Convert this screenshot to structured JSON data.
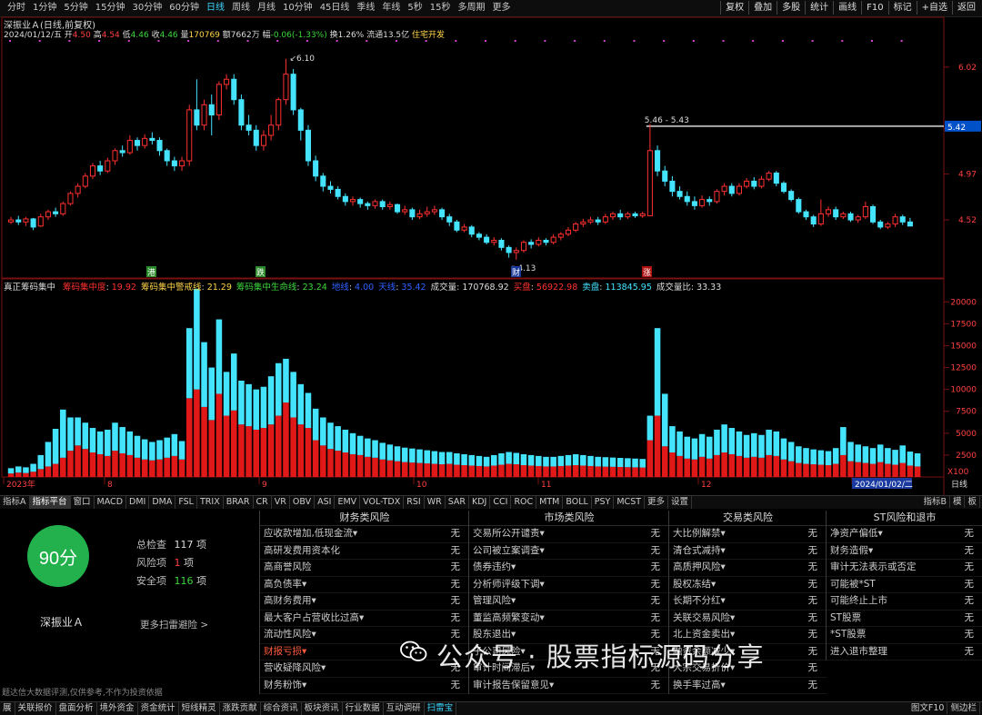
{
  "periods": [
    "分时",
    "1分钟",
    "5分钟",
    "15分钟",
    "30分钟",
    "60分钟",
    "日线",
    "周线",
    "月线",
    "10分钟",
    "45日线",
    "季线",
    "年线",
    "5秒",
    "15秒",
    "多周期",
    "更多"
  ],
  "active_period": "日线",
  "toolbar_right": [
    "复权",
    "叠加",
    "多股",
    "统计",
    "画线",
    "F10",
    "标记",
    "+自选",
    "返回"
  ],
  "stock": {
    "name": "深振业Ａ",
    "mode": "(日线,前复权)"
  },
  "quote": {
    "date": "2024/01/12/五",
    "open_label": "开",
    "open": "4.50",
    "high_label": "高",
    "high": "4.54",
    "low_label": "低",
    "low": "4.46",
    "close_label": "收",
    "close": "4.46",
    "vol_label": "量",
    "vol": "170769",
    "amt_label": "额",
    "amt": "7662万",
    "chg_label": "幅",
    "chg": "-0.06(-1.33%)",
    "turnover": "换1.26%",
    "float": "流通13.5亿",
    "industry": "住宅开发"
  },
  "price_axis": [
    "6.02",
    "5.42",
    "4.97",
    "4.52"
  ],
  "annotations": {
    "high": "6.10",
    "low": "4.13",
    "range": "5.46 - 5.43",
    "current_price": "5.42"
  },
  "markers": {
    "m1": "港",
    "m2": "跌",
    "m3": "财",
    "m4": "涨"
  },
  "vol_axis": [
    "20000",
    "17500",
    "15000",
    "12500",
    "10000",
    "7500",
    "5000",
    "2500",
    "X100"
  ],
  "months": [
    "2023年",
    "8",
    "9",
    "10",
    "11",
    "12",
    "2024/01/02/二"
  ],
  "axis_mode_label": "日线",
  "indicator": {
    "name": "真正筹码集中",
    "items": [
      {
        "label": "筹码集中度",
        "value": "19.92",
        "color": "#ff3030"
      },
      {
        "label": "筹码集中警戒线",
        "value": "21.29",
        "color": "#ffd54a"
      },
      {
        "label": "筹码集中生命线",
        "value": "23.24",
        "color": "#3cd63c"
      },
      {
        "label": "地线",
        "value": "4.00",
        "color": "#3060ff"
      },
      {
        "label": "天线",
        "value": "35.42",
        "color": "#3060ff"
      },
      {
        "label": "成交量",
        "value": "170768.92",
        "color": "#dddddd"
      },
      {
        "label": "买盘",
        "value": "56922.98",
        "color": "#ff3030"
      },
      {
        "label": "卖盘",
        "value": "113845.95",
        "color": "#44e4ff"
      },
      {
        "label": "成交量比",
        "value": "33.33",
        "color": "#dddddd"
      }
    ]
  },
  "indicator_tabs": [
    "指标A",
    "指标平台",
    "窗口",
    "MACD",
    "DMI",
    "DMA",
    "FSL",
    "TRIX",
    "BRAR",
    "CR",
    "VR",
    "OBV",
    "ASI",
    "EMV",
    "VOL-TDX",
    "RSI",
    "WR",
    "SAR",
    "KDJ",
    "CCI",
    "ROC",
    "MTM",
    "BOLL",
    "PSY",
    "MCST",
    "更多",
    "设置"
  ],
  "indicator_tabs_right": [
    "指标B",
    "模",
    "板"
  ],
  "risk": {
    "score": "90分",
    "total_label": "总检查",
    "total": "117",
    "total_unit": "项",
    "risk_label": "风险项",
    "risk_count": "1",
    "risk_unit": "项",
    "safe_label": "安全项",
    "safe": "116",
    "safe_unit": "项",
    "stock_name": "深振业Ａ",
    "more": "更多扫雷避险 >",
    "disclaimer": "题达信大数据评测,仅供参考,不作为投资依据"
  },
  "categories": [
    {
      "title": "财务类风险",
      "items": [
        {
          "label": "应收款增加,低现金流▾",
          "value": "无"
        },
        {
          "label": "高研发费用资本化",
          "value": "无"
        },
        {
          "label": "高商誉风险",
          "value": "无"
        },
        {
          "label": "高负债率▾",
          "value": "无"
        },
        {
          "label": "高财务费用▾",
          "value": "无"
        },
        {
          "label": "最大客户占营收比过高▾",
          "value": "无"
        },
        {
          "label": "流动性风险▾",
          "value": "无"
        },
        {
          "label": "财报亏损▾",
          "value": "",
          "hl": true
        },
        {
          "label": "营收疑降风险▾",
          "value": "无"
        },
        {
          "label": "财务粉饰▾",
          "value": "无"
        }
      ]
    },
    {
      "title": "市场类风险",
      "items": [
        {
          "label": "交易所公开谴责▾",
          "value": "无"
        },
        {
          "label": "公司被立案调查▾",
          "value": "无"
        },
        {
          "label": "债券违约▾",
          "value": "无"
        },
        {
          "label": "分析师评级下调▾",
          "value": "无"
        },
        {
          "label": "管理风险▾",
          "value": "无"
        },
        {
          "label": "董监高频繁变动▾",
          "value": "无"
        },
        {
          "label": "股东退出▾",
          "value": "无"
        },
        {
          "label": "子公司风险▾",
          "value": "无"
        },
        {
          "label": "审计时间滞后▾",
          "value": "无"
        },
        {
          "label": "审计报告保留意见▾",
          "value": "无"
        }
      ]
    },
    {
      "title": "交易类风险",
      "items": [
        {
          "label": "大比例解禁▾",
          "value": "无"
        },
        {
          "label": "清仓式减持▾",
          "value": "无"
        },
        {
          "label": "高质押风险▾",
          "value": "无"
        },
        {
          "label": "股权冻结▾",
          "value": "无"
        },
        {
          "label": "长期不分红▾",
          "value": "无"
        },
        {
          "label": "关联交易风险▾",
          "value": "无"
        },
        {
          "label": "北上资金卖出▾",
          "value": "无"
        },
        {
          "label": "融资余额减少▾",
          "value": "无"
        },
        {
          "label": "大宗交易折价▾",
          "value": "无"
        },
        {
          "label": "换手率过高▾",
          "value": "无"
        }
      ]
    },
    {
      "title": "ST风险和退市",
      "items": [
        {
          "label": "净资产偏低▾",
          "value": "无"
        },
        {
          "label": "财务造假▾",
          "value": "无"
        },
        {
          "label": "审计无法表示或否定",
          "value": "无"
        },
        {
          "label": "可能被*ST",
          "value": "无"
        },
        {
          "label": "可能终止上市",
          "value": "无"
        },
        {
          "label": "ST股票",
          "value": "无"
        },
        {
          "label": "*ST股票",
          "value": "无"
        },
        {
          "label": "进入退市整理",
          "value": "无"
        }
      ]
    }
  ],
  "statusbar": [
    "展",
    "关联报价",
    "盘面分析",
    "境外资金",
    "资金统计",
    "短线精灵",
    "涨跌贡献",
    "综合资讯",
    "板块资讯",
    "行业数据",
    "互动调研",
    "扫雷宝"
  ],
  "statusbar_right": [
    "图文F10",
    "侧边栏"
  ],
  "watermark": "公众号 · 股票指标源码分享",
  "colors": {
    "up": "#ff3030",
    "down": "#44e4ff",
    "bg": "#000000",
    "score": "#22b14c"
  },
  "chart_data": {
    "type": "candlestick",
    "price_range": [
      3.95,
      6.25
    ],
    "candles": [
      [
        4.5,
        4.52,
        4.55,
        4.48
      ],
      [
        4.52,
        4.5,
        4.56,
        4.47
      ],
      [
        4.5,
        4.53,
        4.55,
        4.46
      ],
      [
        4.53,
        4.45,
        4.54,
        4.42
      ],
      [
        4.46,
        4.55,
        4.58,
        4.45
      ],
      [
        4.55,
        4.6,
        4.62,
        4.52
      ],
      [
        4.6,
        4.58,
        4.64,
        4.55
      ],
      [
        4.58,
        4.68,
        4.7,
        4.56
      ],
      [
        4.68,
        4.78,
        4.8,
        4.66
      ],
      [
        4.78,
        4.85,
        4.88,
        4.74
      ],
      [
        4.85,
        4.95,
        4.98,
        4.83
      ],
      [
        4.95,
        5.05,
        5.08,
        4.92
      ],
      [
        5.05,
        5.0,
        5.1,
        4.96
      ],
      [
        5.0,
        5.1,
        5.13,
        4.98
      ],
      [
        5.1,
        5.2,
        5.22,
        5.06
      ],
      [
        5.2,
        5.18,
        5.25,
        5.14
      ],
      [
        5.18,
        5.3,
        5.35,
        5.16
      ],
      [
        5.3,
        5.25,
        5.33,
        5.2
      ],
      [
        5.25,
        5.32,
        5.36,
        5.22
      ],
      [
        5.32,
        5.3,
        5.38,
        5.26
      ],
      [
        5.3,
        5.2,
        5.33,
        5.15
      ],
      [
        5.2,
        5.1,
        5.22,
        5.05
      ],
      [
        5.1,
        5.05,
        5.14,
        5.0
      ],
      [
        5.05,
        5.1,
        5.14,
        5.0
      ],
      [
        5.1,
        5.6,
        5.65,
        5.05
      ],
      [
        5.6,
        5.45,
        5.9,
        5.4
      ],
      [
        5.45,
        5.65,
        5.7,
        5.4
      ],
      [
        5.65,
        5.55,
        5.75,
        5.35
      ],
      [
        5.55,
        5.85,
        5.88,
        5.5
      ],
      [
        5.85,
        5.9,
        5.95,
        5.8
      ],
      [
        5.9,
        5.7,
        5.95,
        5.65
      ],
      [
        5.7,
        5.45,
        5.75,
        5.4
      ],
      [
        5.45,
        5.4,
        5.55,
        5.35
      ],
      [
        5.4,
        5.25,
        5.45,
        5.2
      ],
      [
        5.25,
        5.35,
        5.4,
        5.2
      ],
      [
        5.35,
        5.45,
        5.55,
        5.3
      ],
      [
        5.45,
        5.7,
        5.72,
        5.4
      ],
      [
        5.7,
        5.95,
        6.1,
        5.65
      ],
      [
        5.95,
        5.6,
        6.0,
        5.55
      ],
      [
        5.6,
        5.4,
        5.62,
        5.3
      ],
      [
        5.4,
        5.1,
        5.45,
        5.05
      ],
      [
        5.1,
        4.95,
        5.15,
        4.9
      ],
      [
        4.95,
        4.85,
        4.98,
        4.8
      ],
      [
        4.85,
        4.82,
        4.9,
        4.78
      ],
      [
        4.82,
        4.75,
        4.85,
        4.72
      ],
      [
        4.75,
        4.7,
        4.78,
        4.66
      ],
      [
        4.7,
        4.72,
        4.75,
        4.66
      ],
      [
        4.72,
        4.68,
        4.74,
        4.64
      ],
      [
        4.68,
        4.66,
        4.7,
        4.62
      ],
      [
        4.66,
        4.7,
        4.72,
        4.63
      ],
      [
        4.7,
        4.65,
        4.72,
        4.62
      ],
      [
        4.65,
        4.67,
        4.7,
        4.62
      ],
      [
        4.67,
        4.6,
        4.68,
        4.58
      ],
      [
        4.6,
        4.62,
        4.66,
        4.57
      ],
      [
        4.62,
        4.55,
        4.64,
        4.52
      ],
      [
        4.55,
        4.58,
        4.62,
        4.53
      ],
      [
        4.58,
        4.6,
        4.65,
        4.55
      ],
      [
        4.6,
        4.62,
        4.66,
        4.57
      ],
      [
        4.62,
        4.55,
        4.64,
        4.52
      ],
      [
        4.55,
        4.5,
        4.58,
        4.46
      ],
      [
        4.5,
        4.42,
        4.52,
        4.4
      ],
      [
        4.42,
        4.45,
        4.48,
        4.4
      ],
      [
        4.45,
        4.38,
        4.47,
        4.35
      ],
      [
        4.38,
        4.35,
        4.4,
        4.32
      ],
      [
        4.35,
        4.3,
        4.38,
        4.28
      ],
      [
        4.3,
        4.32,
        4.35,
        4.27
      ],
      [
        4.32,
        4.25,
        4.34,
        4.22
      ],
      [
        4.25,
        4.2,
        4.27,
        4.15
      ],
      [
        4.2,
        4.22,
        4.25,
        4.13
      ],
      [
        4.22,
        4.3,
        4.32,
        4.2
      ],
      [
        4.3,
        4.28,
        4.33,
        4.24
      ],
      [
        4.28,
        4.32,
        4.35,
        4.26
      ],
      [
        4.32,
        4.3,
        4.34,
        4.27
      ],
      [
        4.3,
        4.35,
        4.38,
        4.28
      ],
      [
        4.35,
        4.38,
        4.4,
        4.32
      ],
      [
        4.38,
        4.42,
        4.45,
        4.36
      ],
      [
        4.42,
        4.48,
        4.5,
        4.4
      ],
      [
        4.48,
        4.5,
        4.53,
        4.45
      ],
      [
        4.5,
        4.52,
        4.55,
        4.48
      ],
      [
        4.52,
        4.5,
        4.55,
        4.47
      ],
      [
        4.5,
        4.55,
        4.58,
        4.48
      ],
      [
        4.55,
        4.58,
        4.6,
        4.52
      ],
      [
        4.58,
        4.55,
        4.62,
        4.52
      ],
      [
        4.55,
        4.58,
        4.6,
        4.53
      ],
      [
        4.58,
        4.56,
        4.6,
        4.54
      ],
      [
        4.56,
        4.58,
        4.6,
        4.54
      ],
      [
        4.56,
        5.2,
        5.46,
        4.95
      ],
      [
        5.2,
        5.0,
        5.25,
        4.95
      ],
      [
        5.0,
        4.9,
        5.05,
        4.85
      ],
      [
        4.9,
        4.8,
        4.95,
        4.75
      ],
      [
        4.8,
        4.75,
        4.85,
        4.72
      ],
      [
        4.75,
        4.7,
        4.8,
        4.66
      ],
      [
        4.7,
        4.66,
        4.75,
        4.62
      ],
      [
        4.66,
        4.72,
        4.76,
        4.64
      ],
      [
        4.72,
        4.7,
        4.75,
        4.66
      ],
      [
        4.7,
        4.8,
        4.82,
        4.68
      ],
      [
        4.8,
        4.85,
        4.88,
        4.76
      ],
      [
        4.85,
        4.78,
        4.88,
        4.75
      ],
      [
        4.78,
        4.85,
        4.88,
        4.76
      ],
      [
        4.85,
        4.9,
        4.93,
        4.83
      ],
      [
        4.9,
        4.85,
        4.94,
        4.82
      ],
      [
        4.85,
        4.92,
        4.95,
        4.83
      ],
      [
        4.92,
        4.98,
        5.0,
        4.9
      ],
      [
        4.98,
        4.88,
        5.0,
        4.85
      ],
      [
        4.88,
        4.8,
        4.9,
        4.78
      ],
      [
        4.8,
        4.72,
        4.82,
        4.7
      ],
      [
        4.72,
        4.6,
        4.74,
        4.58
      ],
      [
        4.6,
        4.55,
        4.62,
        4.52
      ],
      [
        4.55,
        4.48,
        4.57,
        4.45
      ],
      [
        4.48,
        4.58,
        4.72,
        4.46
      ],
      [
        4.58,
        4.62,
        4.65,
        4.55
      ],
      [
        4.62,
        4.55,
        4.65,
        4.52
      ],
      [
        4.55,
        4.58,
        4.6,
        4.53
      ],
      [
        4.58,
        4.52,
        4.6,
        4.5
      ],
      [
        4.52,
        4.55,
        4.57,
        4.49
      ],
      [
        4.55,
        4.65,
        4.7,
        4.53
      ],
      [
        4.65,
        4.5,
        4.67,
        4.48
      ],
      [
        4.5,
        4.45,
        4.52,
        4.43
      ],
      [
        4.45,
        4.48,
        4.5,
        4.43
      ],
      [
        4.48,
        4.55,
        4.58,
        4.45
      ],
      [
        4.55,
        4.5,
        4.57,
        4.47
      ],
      [
        4.5,
        4.46,
        4.54,
        4.46
      ]
    ],
    "volume_range": [
      0,
      22000
    ],
    "buy": [
      400,
      500,
      450,
      600,
      900,
      1200,
      1500,
      2200,
      3000,
      3600,
      3200,
      2800,
      2600,
      2400,
      3000,
      2700,
      2500,
      2200,
      2000,
      1900,
      2000,
      2200,
      2400,
      2000,
      9000,
      10000,
      8000,
      6500,
      9500,
      7000,
      7600,
      6000,
      5800,
      5400,
      5600,
      6000,
      7000,
      8500,
      6800,
      6000,
      5600,
      4200,
      3600,
      3200,
      3000,
      2800,
      2600,
      2500,
      2300,
      2200,
      2000,
      1900,
      1800,
      1700,
      1650,
      1600,
      1550,
      1500,
      1450,
      1500,
      1400,
      1350,
      1300,
      1250,
      1200,
      1300,
      1400,
      1500,
      1450,
      1350,
      1300,
      1250,
      1200,
      1200,
      1250,
      1300,
      1350,
      1300,
      1250,
      1200,
      1180,
      1160,
      1140,
      1120,
      1100,
      1080,
      4200,
      7000,
      3500,
      2800,
      2400,
      2100,
      2000,
      2300,
      2100,
      2500,
      2800,
      2600,
      2400,
      2200,
      2300,
      2200,
      2500,
      2400,
      2000,
      1800,
      1600,
      1500,
      1450,
      1400,
      1350,
      1500,
      2500,
      1800,
      1700,
      1600,
      1500,
      1700,
      1500,
      1400,
      1600,
      1300,
      1200
    ],
    "sell": [
      600,
      700,
      650,
      900,
      1600,
      2800,
      4000,
      5500,
      3800,
      3200,
      3000,
      2800,
      2600,
      3000,
      3200,
      3000,
      2700,
      2500,
      2300,
      2100,
      2200,
      2300,
      2500,
      2100,
      8000,
      11500,
      7400,
      6000,
      8500,
      5000,
      6500,
      5000,
      4800,
      4600,
      4700,
      5500,
      6000,
      5000,
      5200,
      4600,
      4000,
      3600,
      3200,
      3000,
      2800,
      2600,
      2400,
      2200,
      2100,
      2000,
      1900,
      1800,
      1700,
      1650,
      1600,
      1550,
      1500,
      1450,
      1400,
      1350,
      1300,
      1250,
      1200,
      1150,
      1100,
      1200,
      1300,
      1350,
      1300,
      1250,
      1200,
      1150,
      1100,
      1100,
      1150,
      1200,
      1250,
      1200,
      1150,
      1100,
      1080,
      1060,
      1040,
      1020,
      1000,
      980,
      2800,
      10000,
      6000,
      3000,
      2800,
      2500,
      2400,
      2600,
      2500,
      2900,
      3200,
      3000,
      2800,
      2600,
      2700,
      2600,
      2900,
      2800,
      2400,
      2200,
      1900,
      1800,
      1700,
      1650,
      1600,
      1800,
      3200,
      2200,
      2000,
      1900,
      1800,
      2000,
      1800,
      1700,
      2000,
      1600,
      1500
    ]
  }
}
